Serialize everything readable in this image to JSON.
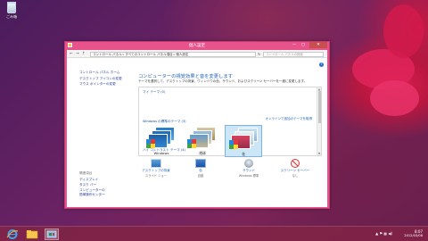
{
  "desktop": {
    "recycle_bin_label": "ごみ箱"
  },
  "window": {
    "title": "個人設定",
    "minimize_glyph": "—",
    "maximize_glyph": "▢",
    "close_glyph": "✕"
  },
  "addressbar": {
    "back_glyph": "←",
    "forward_glyph": "→",
    "up_glyph": "↑",
    "crumbs": [
      "コントロール パネル",
      "すべてのコントロール パネル項目",
      "個人設定"
    ],
    "separator": "▸",
    "refresh_glyph": "↻",
    "search_placeholder": "コントロール パネルの検索"
  },
  "sidebar": {
    "home": "コントロール パネル ホーム",
    "links": [
      "デスクトップ アイコンの変更",
      "マウス ポインターの変更"
    ],
    "see_also_title": "関連項目",
    "see_also": [
      "ディスプレイ",
      "タスク バー",
      "コンピューターの",
      "簡単操作センター"
    ]
  },
  "main": {
    "help_glyph": "?",
    "heading": "コンピューターの視覚効果と音を変更します",
    "description": "テーマを選択して、デスクトップの背景、ウィンドウの色、サウンド、およびスクリーン セーバーを一度に変更します。",
    "my_themes_header": "マイ テーマ (0)",
    "windows_themes_header": "Windows の標準のテーマ (3)",
    "online_link": "オンラインで追加のテーマを取得",
    "high_contrast_header": "ハイ コントラスト テーマ (4)",
    "themes": [
      {
        "name": "Windows",
        "selected": false
      },
      {
        "name": "地球",
        "selected": false
      },
      {
        "name": "花",
        "selected": true
      }
    ],
    "bottom_items": [
      {
        "label": "デスクトップの背景",
        "value": "スライド ショー"
      },
      {
        "label": "色",
        "value": "自動"
      },
      {
        "label": "サウンド",
        "value": "Windows 標準"
      },
      {
        "label": "スクリーン セーバー",
        "value": "なし"
      }
    ]
  },
  "taskbar": {
    "time": "8:07",
    "date": "2012/03/08",
    "tray_glyphs": "▲ ⚑ ▦ ◀)"
  }
}
